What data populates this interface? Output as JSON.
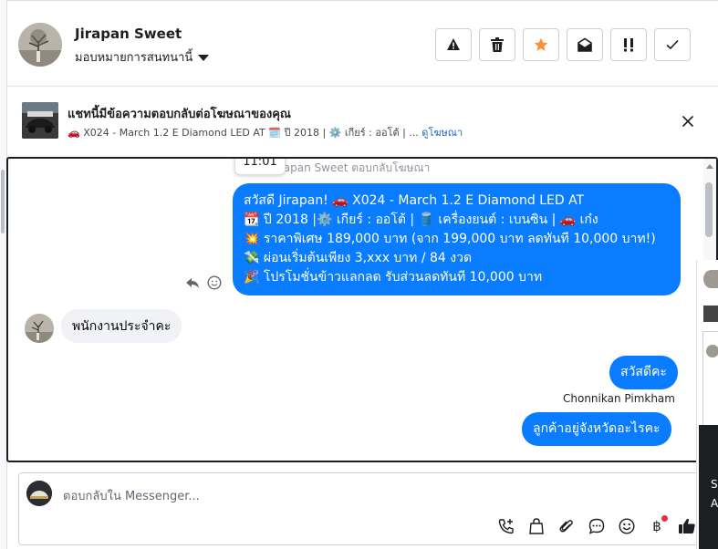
{
  "contact": {
    "name": "Jirapan Sweet",
    "assign_label": "มอบหมายการสนทนานี้"
  },
  "ad_banner": {
    "title": "แชทนี้มีข้อความตอบกลับต่อโฆษณาของคุณ",
    "car_emoji": "🚗",
    "model": "X024 - March 1.2 E Diamond LED AT",
    "calendar_emoji": "🗓️",
    "year": "ปี 2018 |",
    "gear_emoji": "⚙️",
    "gear": "เกียร์ : ออโต้ | ...",
    "link": "ดูโฆษณา"
  },
  "conversation": {
    "tooltip_time": "11:01",
    "system_line": "Jirapan Sweet ตอบกลับโฆษณา",
    "ad_message_lines": [
      "สวัสดี Jirapan! 🚗 X024 - March 1.2 E Diamond LED AT",
      "📆 ปี 2018 |⚙️ เกียร์ : ออโต้ | 🛢️ เครื่องยนต์ : เบนซิน | 🚗 เก๋ง",
      "💥 ราคาพิเศษ 189,000 บาท (จาก 199,000 บาท ลดทันที 10,000 บาท!)",
      "💸 ผ่อนเริ่มต้นเพียง 3,xxx บาท / 84 งวด",
      "🎉 โปรโมชั่นข้าวแลกลด รับส่วนลดทันที 10,000 บาท"
    ],
    "incoming_message": "พนักงานประจำคะ",
    "outgoing_hello": "สวัสดีคะ",
    "sender_name": "Chonnikan Pimkham",
    "outgoing_question": "ลูกค้าอยู่จังหวัดอะไรคะ"
  },
  "side_panel": {
    "letter_s": "S",
    "letter_a": "A"
  },
  "composer": {
    "placeholder": "ตอบกลับใน Messenger...",
    "currency_glyph": "฿"
  },
  "colors": {
    "outgoing_bubble": "#0a7cff",
    "incoming_bubble": "#f0f2f5",
    "star": "#f7923a",
    "link": "#1664c9",
    "notification_dot": "#f02849"
  },
  "icons": {
    "header_buttons": [
      "warning-icon",
      "trash-icon",
      "star-icon",
      "envelope-open-icon",
      "double-exclamation-icon",
      "check-icon"
    ],
    "composer_tools": [
      "phone-plus-icon",
      "shopping-bag-icon",
      "paperclip-icon",
      "chat-bubble-icon",
      "smiley-icon",
      "baht-icon",
      "thumbs-up-icon"
    ]
  }
}
